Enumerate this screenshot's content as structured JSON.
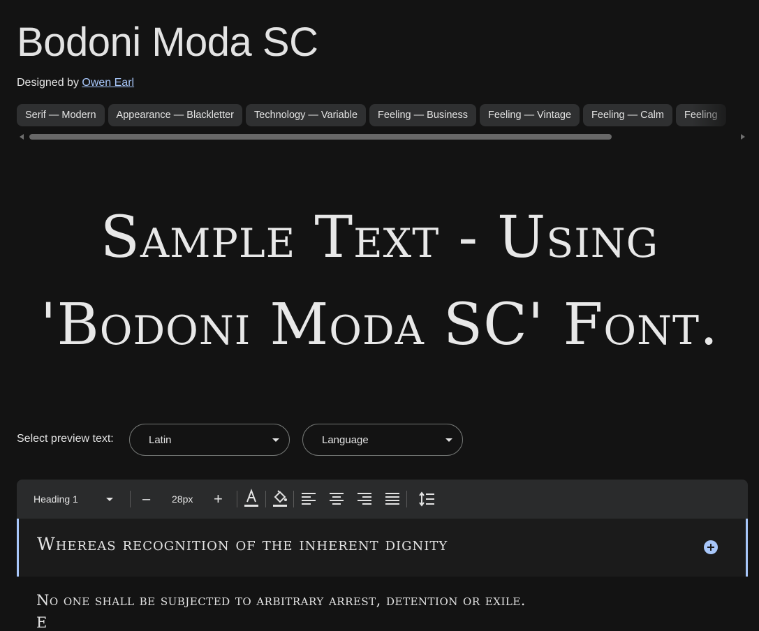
{
  "header": {
    "title": "Bodoni Moda SC",
    "designed_by_prefix": "Designed by ",
    "designer": "Owen Earl"
  },
  "tags": [
    "Serif — Modern",
    "Appearance — Blackletter",
    "Technology — Variable",
    "Feeling — Business",
    "Feeling — Vintage",
    "Feeling — Calm",
    "Feeling"
  ],
  "sample": {
    "line1": "Sample Text - Using",
    "line2": "'Bodoni Moda SC' Font."
  },
  "preview": {
    "label": "Select preview text:",
    "script_select": "Latin",
    "language_select": "Language"
  },
  "toolbar": {
    "style_select": "Heading 1",
    "decrease": "–",
    "font_size": "28px",
    "increase": "+"
  },
  "editor": {
    "heading_text": "Whereas recognition of the inherent dignity",
    "paragraph_text": "No one shall be subjected to arbitrary arrest, detention or exile.",
    "next_line_partial": "E"
  },
  "colors": {
    "background": "#131313",
    "accent": "#a8c7fa",
    "chip": "#2f3031",
    "toolbar": "#2a2b2c"
  }
}
